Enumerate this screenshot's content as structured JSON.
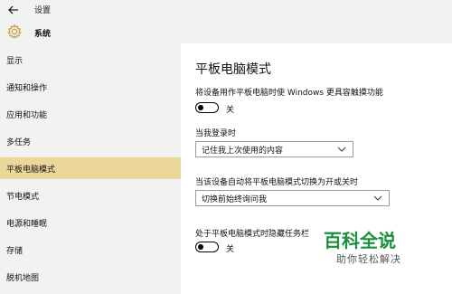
{
  "window": {
    "title": "设置"
  },
  "header": {
    "title": "系统",
    "icon": "gear-icon"
  },
  "sidebar": {
    "items": [
      {
        "label": "显示",
        "active": false
      },
      {
        "label": "通知和操作",
        "active": false
      },
      {
        "label": "应用和功能",
        "active": false
      },
      {
        "label": "多任务",
        "active": false
      },
      {
        "label": "平板电脑模式",
        "active": true
      },
      {
        "label": "节电模式",
        "active": false
      },
      {
        "label": "电源和睡眠",
        "active": false
      },
      {
        "label": "存储",
        "active": false
      },
      {
        "label": "脱机地图",
        "active": false
      }
    ]
  },
  "main": {
    "title": "平板电脑模式",
    "setting1": {
      "label": "将设备用作平板电脑时使 Windows 更具容触摸功能",
      "toggle_state": "关"
    },
    "setting2": {
      "label": "当我登录时",
      "selected": "记住我上次使用的内容"
    },
    "setting3": {
      "label": "当该设备自动将平板电脑模式切换为开或关时",
      "selected": "切换前始终询问我"
    },
    "setting4": {
      "label": "处于平板电脑模式时隐藏任务栏",
      "toggle_state": "关"
    }
  },
  "watermark": {
    "logo": "百科全说",
    "sub": "助你轻松解决"
  },
  "colors": {
    "sidebar_bg": "#f2f2f2",
    "active_item": "#ecd79b",
    "watermark_green": "#1a8f3c"
  }
}
